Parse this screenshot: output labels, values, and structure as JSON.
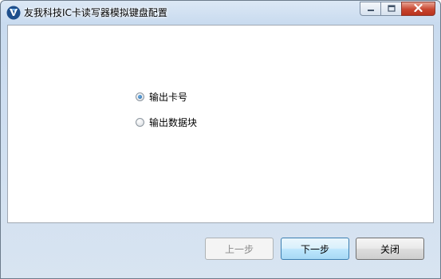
{
  "window": {
    "title": "友我科技IC卡读写器模拟键盘配置",
    "controls": {
      "minimize": "minimize-icon",
      "maximize": "maximize-icon",
      "close": "close-icon"
    }
  },
  "options": [
    {
      "label": "输出卡号",
      "checked": true
    },
    {
      "label": "输出数据块",
      "checked": false
    }
  ],
  "buttons": {
    "prev": {
      "label": "上一步",
      "enabled": false
    },
    "next": {
      "label": "下一步",
      "enabled": true
    },
    "close": {
      "label": "关闭",
      "enabled": true
    }
  },
  "colors": {
    "accent": "#1d5f9e",
    "close_button": "#c8452f"
  }
}
